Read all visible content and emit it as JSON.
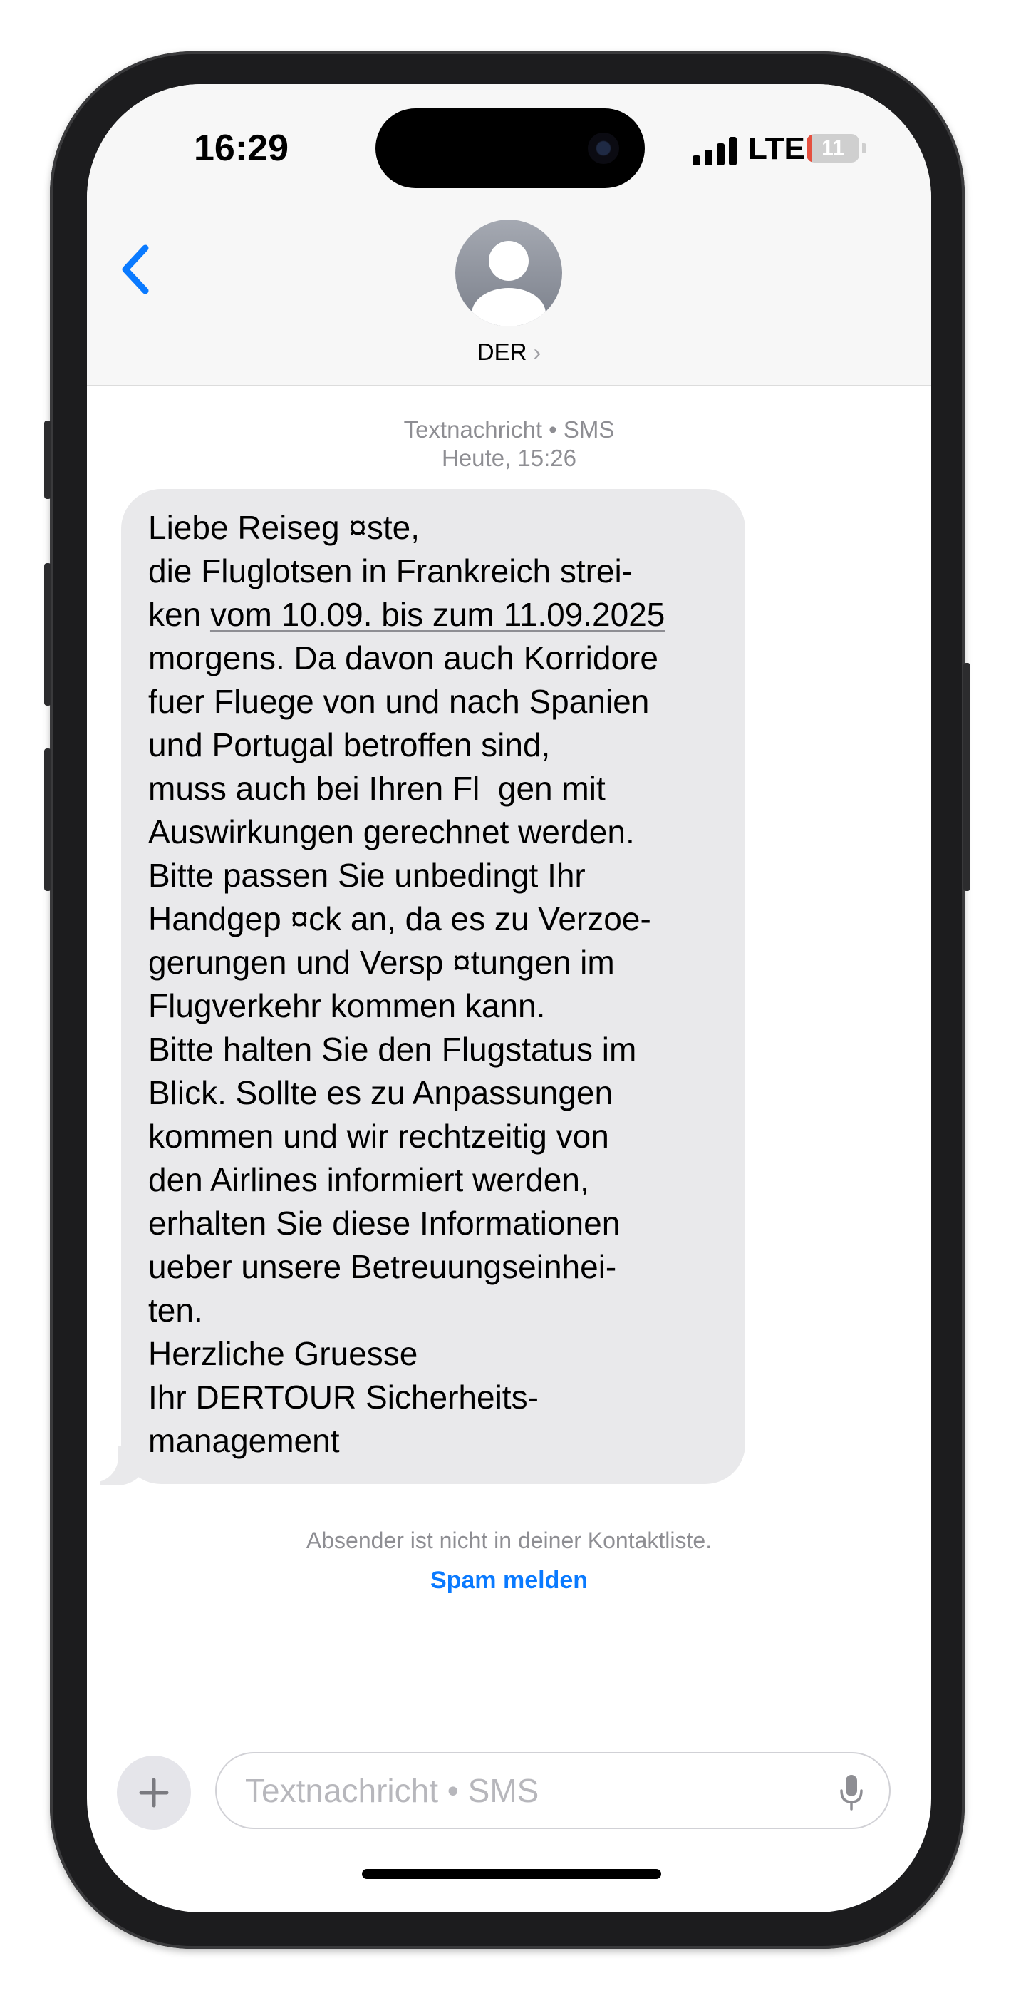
{
  "status_bar": {
    "time": "16:29",
    "network": "LTE",
    "battery": "11",
    "battery_level_percent": 11
  },
  "header": {
    "contact_name": "DER",
    "chevron": "›"
  },
  "message_meta": {
    "type_label": "Textnachricht • SMS",
    "timestamp": "Heute, 15:26"
  },
  "message": {
    "lines": [
      "Liebe Reiseg ¤ste,",
      "die Fluglotsen in Frankreich strei-",
      "ken ",
      "morgens. Da davon auch Korridore",
      "fuer Fluege von und nach Spanien",
      "und Portugal betroffen sind,",
      "muss auch bei Ihren Fl  gen mit",
      "Auswirkungen gerechnet werden.",
      "Bitte passen Sie unbedingt Ihr",
      "Handgep ¤ck an, da es zu Verzoe-",
      "gerungen und Versp ¤tungen im",
      "Flugverkehr kommen kann.",
      "Bitte halten Sie den Flugstatus im",
      "Blick. Sollte es zu Anpassungen",
      "kommen und wir rechtzeitig von",
      "den Airlines informiert werden,",
      "erhalten Sie diese Informationen",
      "ueber unsere Betreuungseinhei-",
      "ten.",
      "Herzliche Gruesse",
      "Ihr DERTOUR Sicherheits-",
      "management"
    ],
    "date_link": "vom 10.09. bis zum 11.09.2025"
  },
  "notice": {
    "text": "Absender ist nicht in deiner Kontaktliste.",
    "spam_label": "Spam melden"
  },
  "compose": {
    "placeholder": "Textnachricht • SMS",
    "plus_symbol": "+"
  },
  "colors": {
    "accent": "#0a7aff",
    "bubble": "#e9e9eb",
    "battery_low": "#e5503f"
  },
  "icons": [
    "back-chevron-icon",
    "person-icon",
    "plus-icon",
    "microphone-icon",
    "signal-icon",
    "battery-icon"
  ]
}
